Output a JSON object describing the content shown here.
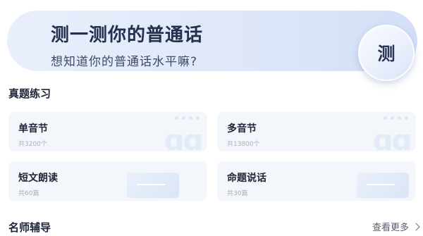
{
  "banner": {
    "title": "测一测你的普通话",
    "subtitle": "想知道你的普通话水平嘛?",
    "button_label": "测"
  },
  "practice_section": {
    "title": "真题练习",
    "cards": [
      {
        "title": "单音节",
        "count": "共3200个"
      },
      {
        "title": "多音节",
        "count": "共13800个"
      },
      {
        "title": "短文朗读",
        "count": "共60篇"
      },
      {
        "title": "命题说话",
        "count": "共30篇"
      }
    ]
  },
  "tutor_section": {
    "title": "名师辅导",
    "more_label": "查看更多"
  }
}
